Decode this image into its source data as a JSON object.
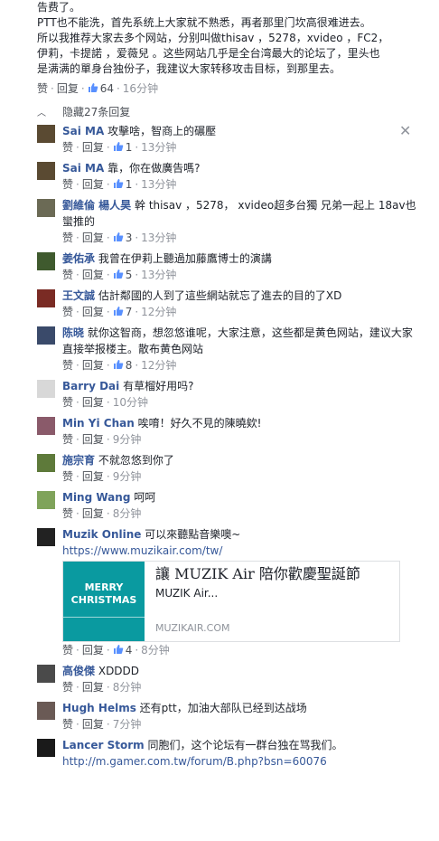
{
  "top_comment": {
    "lines": [
      "告费了。",
      "PTT也不能洗，首先系统上大家就不熟悉，再者那里门坎高很难进去。",
      "所以我推荐大家去多个网站，分别叫做thisav ，5278，xvideo ，FC2，",
      "伊莉，卡提諾 ，爱薇兒 。这些网站几乎是全台湾最大的论坛了，里头也",
      "是满满的單身台独份子，我建议大家转移攻击目标，到那里去。"
    ],
    "like_label": "赞",
    "reply_label": "回复",
    "likes": "64",
    "time": "16分钟"
  },
  "hidden_replies_label": "隐藏27条回复",
  "close_glyph": "✕",
  "replies": [
    {
      "name": "Sai MA",
      "text": "攻擊啥，智商上的碾壓",
      "likes": "1",
      "time": "13分钟",
      "avatar_color": "#5a4a32"
    },
    {
      "name": "Sai MA",
      "text": "靠，你在做廣告嗎?",
      "likes": "1",
      "time": "13分钟",
      "avatar_color": "#5a4a32"
    },
    {
      "name": "劉維倫 楊人昊",
      "text": "幹 thisav ，5278， xvideo超多台獨 兄弟一起上 18av也蠻推的",
      "likes": "3",
      "time": "13分钟",
      "avatar_color": "#6b6a55"
    },
    {
      "name": "姜佑承",
      "text": "我曾在伊莉上聽過加藤鷹博士的演講",
      "likes": "5",
      "time": "13分钟",
      "avatar_color": "#3f5a2e"
    },
    {
      "name": "王文誠",
      "text": "估計鄰國的人到了這些網站就忘了進去的目的了XD",
      "likes": "7",
      "time": "12分钟",
      "avatar_color": "#7a2b24"
    },
    {
      "name": "陈晓",
      "text": "就你这智商，想忽悠谁呢，大家注意，这些都是黄色网站，建议大家直接举报楼主。散布黄色网站",
      "likes": "8",
      "time": "12分钟",
      "avatar_color": "#3a4a6a"
    },
    {
      "name": "Barry Dai",
      "text": "有草榴好用吗?",
      "likes": "",
      "time": "10分钟",
      "avatar_color": "#d8d8d8"
    },
    {
      "name": "Min Yi Chan",
      "text": "唉唷！好久不見的陳曉欸!",
      "likes": "",
      "time": "9分钟",
      "avatar_color": "#8a5a6a"
    },
    {
      "name": "施宗育",
      "text": "不就忽悠到你了",
      "likes": "",
      "time": "9分钟",
      "avatar_color": "#5e7a3a"
    },
    {
      "name": "Ming Wang",
      "text": "呵呵",
      "likes": "",
      "time": "8分钟",
      "avatar_color": "#7fa35a"
    },
    {
      "name": "Muzik Online",
      "text": "可以來聽點音樂噢~",
      "link": "https://www.muzikair.com/tw/",
      "preview": {
        "title": "讓 MUZIK Air 陪你歡慶聖誕節",
        "desc": "MUZIK Air...",
        "domain": "MUZIKAIR.COM",
        "thumb_line1": "MERRY",
        "thumb_line2": "CHRISTMAS"
      },
      "likes": "4",
      "time": "8分钟",
      "avatar_color": "#222222"
    },
    {
      "name": "高俊傑",
      "text": "XDDDD",
      "likes": "",
      "time": "8分钟",
      "avatar_color": "#4a4a4a"
    },
    {
      "name": "Hugh Helms",
      "text": "还有ptt，加油大部队已经到达战场",
      "likes": "",
      "time": "7分钟",
      "avatar_color": "#6a5a55"
    },
    {
      "name": "Lancer Storm",
      "text": "同胞们，这个论坛有一群台独在骂我们。",
      "link": "http://m.gamer.com.tw/forum/B.php?bsn=60076",
      "likes": "",
      "time": "",
      "avatar_color": "#1a1a1a"
    }
  ]
}
